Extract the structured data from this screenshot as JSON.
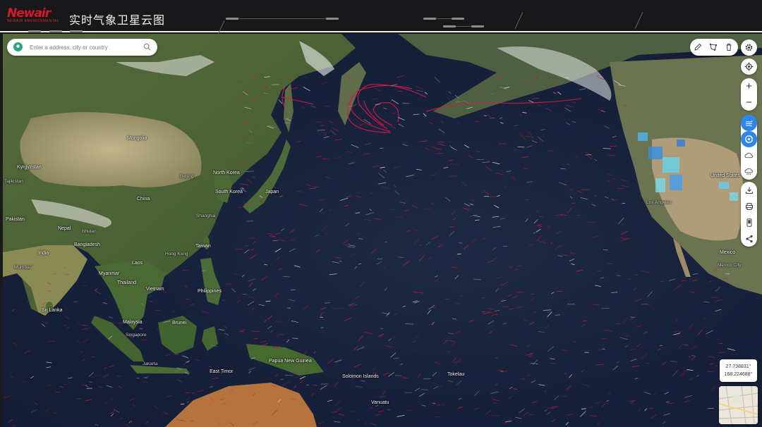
{
  "header": {
    "logo_text": "Newair",
    "logo_subtext": "NEWAIR ENVIRONMENTAL",
    "title": "实时气象卫星云图"
  },
  "search": {
    "placeholder": "Enter a address, city or country"
  },
  "toolbar_right": {
    "draw_tools": [
      "pencil-icon",
      "polygon-icon",
      "trash-icon"
    ],
    "buttons": [
      "settings-icon",
      "locate-icon",
      "zoom-in-icon",
      "zoom-out-icon",
      "wind-layer-icon",
      "typhoon-layer-icon",
      "cloud-layer-icon",
      "rain-layer-icon",
      "download-icon",
      "print-icon",
      "mobile-icon",
      "share-icon"
    ],
    "active_layers": [
      "wind-layer-icon",
      "typhoon-layer-icon"
    ],
    "zoom_in_label": "+",
    "zoom_out_label": "−"
  },
  "coordinates": {
    "lat": "27.738831°",
    "lon": "168.224688°"
  },
  "map_labels": [
    {
      "name": "Mongolia",
      "kind": "country"
    },
    {
      "name": "Kyrgyzstan",
      "kind": "country"
    },
    {
      "name": "Tajikistan",
      "kind": "country"
    },
    {
      "name": "Pakistan",
      "kind": "country"
    },
    {
      "name": "Nepal",
      "kind": "country"
    },
    {
      "name": "Bhutan",
      "kind": "country"
    },
    {
      "name": "Bangladesh",
      "kind": "country"
    },
    {
      "name": "India",
      "kind": "country"
    },
    {
      "name": "China",
      "kind": "country"
    },
    {
      "name": "Mumbai",
      "kind": "city"
    },
    {
      "name": "Myanmar",
      "kind": "country"
    },
    {
      "name": "Laos",
      "kind": "country"
    },
    {
      "name": "Thailand",
      "kind": "country"
    },
    {
      "name": "Vietnam",
      "kind": "country"
    },
    {
      "name": "Sri Lanka",
      "kind": "country"
    },
    {
      "name": "Malaysia",
      "kind": "country"
    },
    {
      "name": "Singapore",
      "kind": "city"
    },
    {
      "name": "Brunei",
      "kind": "country"
    },
    {
      "name": "Jakarta",
      "kind": "city"
    },
    {
      "name": "Hong Kong",
      "kind": "city"
    },
    {
      "name": "Taiwan",
      "kind": "country"
    },
    {
      "name": "Philippines",
      "kind": "country"
    },
    {
      "name": "Shanghai",
      "kind": "city"
    },
    {
      "name": "Beijing",
      "kind": "city"
    },
    {
      "name": "North Korea",
      "kind": "country"
    },
    {
      "name": "South Korea",
      "kind": "country"
    },
    {
      "name": "Japan",
      "kind": "country"
    },
    {
      "name": "East Timor",
      "kind": "country"
    },
    {
      "name": "Papua New Guinea",
      "kind": "country"
    },
    {
      "name": "Solomon Islands",
      "kind": "country"
    },
    {
      "name": "Vanuatu",
      "kind": "country"
    },
    {
      "name": "Tokelau",
      "kind": "country"
    },
    {
      "name": "United States",
      "kind": "country"
    },
    {
      "name": "Los Angeles",
      "kind": "city"
    },
    {
      "name": "Mexico",
      "kind": "country"
    },
    {
      "name": "Mexico City",
      "kind": "city"
    }
  ],
  "colors": {
    "accent": "#2e86e8",
    "wind_particles": "#d21a3c",
    "ocean": "#17203a",
    "header_bg": "#18181a",
    "logo": "#d6182a"
  }
}
